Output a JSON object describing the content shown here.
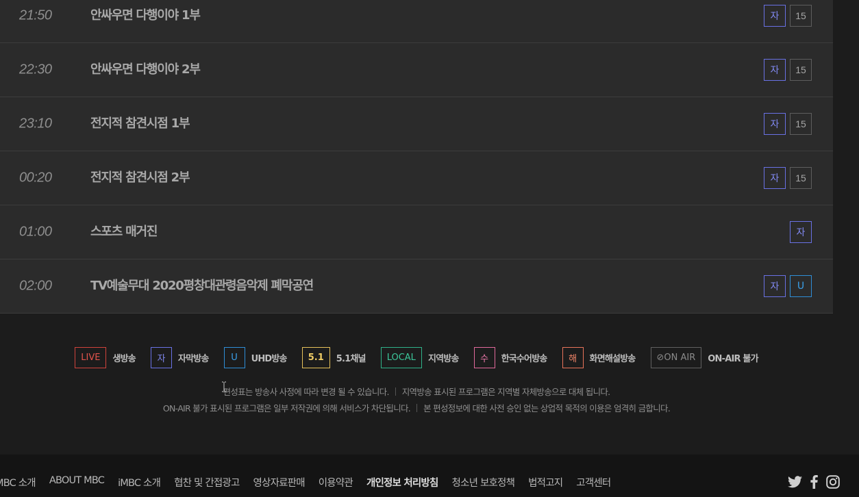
{
  "schedule": [
    {
      "time": "21:50",
      "title": "안싸우면 다행이야 1부",
      "badges": [
        {
          "type": "sub",
          "label": "자"
        },
        {
          "type": "age",
          "label": "15"
        }
      ]
    },
    {
      "time": "22:30",
      "title": "안싸우면 다행이야 2부",
      "badges": [
        {
          "type": "sub",
          "label": "자"
        },
        {
          "type": "age",
          "label": "15"
        }
      ]
    },
    {
      "time": "23:10",
      "title": "전지적 참견시점 1부",
      "badges": [
        {
          "type": "sub",
          "label": "자"
        },
        {
          "type": "age",
          "label": "15"
        }
      ]
    },
    {
      "time": "00:20",
      "title": "전지적 참견시점 2부",
      "badges": [
        {
          "type": "sub",
          "label": "자"
        },
        {
          "type": "age",
          "label": "15"
        }
      ]
    },
    {
      "time": "01:00",
      "title": "스포츠 매거진",
      "badges": [
        {
          "type": "sub",
          "label": "자"
        }
      ]
    },
    {
      "time": "02:00",
      "title": "TV예술무대 2020평창대관령음악제 폐막공연",
      "badges": [
        {
          "type": "sub",
          "label": "자"
        },
        {
          "type": "uhd",
          "label": "U"
        }
      ]
    }
  ],
  "legend": [
    {
      "box": "LIVE",
      "label": "생방송"
    },
    {
      "box": "자",
      "label": "자막방송"
    },
    {
      "box": "U",
      "label": "UHD방송"
    },
    {
      "box": "5.1",
      "label": "5.1채널"
    },
    {
      "box": "LOCAL",
      "label": "지역방송"
    },
    {
      "box": "수",
      "label": "한국수어방송"
    },
    {
      "box": "해",
      "label": "화면해설방송"
    },
    {
      "box": "⊘ON AIR",
      "label": "ON-AIR 불가"
    }
  ],
  "notices": {
    "line1_a": "편성표는 방송사 사정에 따라 변경 될 수 있습니다.",
    "line1_b": "지역방송 표시된 프로그램은 지역별 자체방송으로 대체 됩니다.",
    "line2_a": "ON-AIR 불가 표시된 프로그램은 일부 저작권에 의해 서비스가 차단됩니다.",
    "line2_b": "본 편성정보에 대한 사전 승인 없는 상업적 목적의 이용은 엄격히 금합니다."
  },
  "footer": {
    "links": [
      "MBC 소개",
      "ABOUT MBC",
      "iMBC 소개",
      "협찬 및 간접광고",
      "영상자료판매",
      "이용약관",
      "개인정보 처리방침",
      "청소년 보호정책",
      "법적고지",
      "고객센터"
    ],
    "bold_link": "개인정보 처리방침",
    "social_icons": [
      "twitter-icon",
      "facebook-icon",
      "instagram-icon"
    ]
  },
  "colors": {
    "subtitle": "#6a72e6",
    "live": "#d0433c",
    "uhd": "#2f8fd8",
    "channel51": "#e7c25a",
    "local": "#2fb38a",
    "sign": "#e26a9c",
    "description": "#e9745a"
  }
}
